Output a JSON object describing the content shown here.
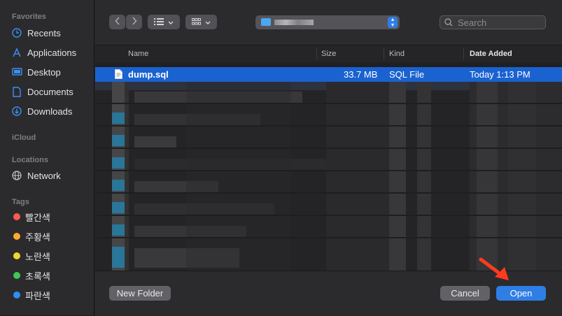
{
  "sidebar": {
    "favorites_title": "Favorites",
    "favorites": [
      {
        "label": "Recents",
        "icon": "clock-icon"
      },
      {
        "label": "Applications",
        "icon": "applications-icon"
      },
      {
        "label": "Desktop",
        "icon": "desktop-icon"
      },
      {
        "label": "Documents",
        "icon": "document-icon"
      },
      {
        "label": "Downloads",
        "icon": "download-icon"
      }
    ],
    "icloud_title": "iCloud",
    "locations_title": "Locations",
    "locations": [
      {
        "label": "Network",
        "icon": "globe-icon"
      }
    ],
    "tags_title": "Tags",
    "tags": [
      {
        "label": "빨간색",
        "color": "#ff5a52"
      },
      {
        "label": "주황색",
        "color": "#ffaa2b"
      },
      {
        "label": "노란색",
        "color": "#f3d42a"
      },
      {
        "label": "초록색",
        "color": "#40c655"
      },
      {
        "label": "파란색",
        "color": "#2d8ef8"
      }
    ]
  },
  "toolbar": {
    "search_placeholder": "Search",
    "icons": [
      "chevron-left-icon",
      "chevron-right-icon",
      "list-view-icon",
      "grid-view-icon",
      "folder-icon"
    ]
  },
  "columns": {
    "name": "Name",
    "size": "Size",
    "kind": "Kind",
    "date": "Date Added"
  },
  "selected_file": {
    "name": "dump.sql",
    "size": "33.7 MB",
    "kind": "SQL File",
    "date": "Today 1:13 PM"
  },
  "buttons": {
    "new_folder": "New Folder",
    "cancel": "Cancel",
    "open": "Open"
  },
  "colors": {
    "accent": "#2f7ee6",
    "selection": "#1a62d0",
    "annotation_arrow": "#ff3b1f"
  }
}
